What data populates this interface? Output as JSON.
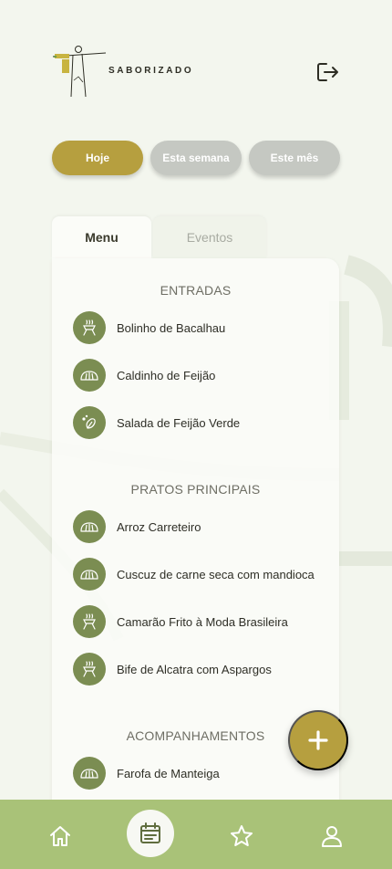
{
  "app": {
    "brand": "SABORIZADO"
  },
  "header": {
    "logo_icon": "christ-redeemer-logo",
    "logout_icon": "logout-icon"
  },
  "filters": [
    {
      "label": "Hoje",
      "active": true
    },
    {
      "label": "Esta semana",
      "active": false
    },
    {
      "label": "Este mês",
      "active": false
    }
  ],
  "tabs": [
    {
      "label": "Menu",
      "active": true
    },
    {
      "label": "Eventos",
      "active": false
    }
  ],
  "sections": [
    {
      "title": "ENTRADAS",
      "items": [
        {
          "name": "Bolinho de Bacalhau",
          "icon": "grill-icon"
        },
        {
          "name": "Caldinho de Feijão",
          "icon": "bread-icon"
        },
        {
          "name": "Salada de Feijão Verde",
          "icon": "salad-icon"
        }
      ]
    },
    {
      "title": "PRATOS PRINCIPAIS",
      "items": [
        {
          "name": "Arroz Carreteiro",
          "icon": "bread-icon"
        },
        {
          "name": "Cuscuz de carne seca com mandioca",
          "icon": "bread-icon"
        },
        {
          "name": "Camarão Frito à Moda Brasileira",
          "icon": "grill-icon"
        },
        {
          "name": "Bife de Alcatra com Aspargos",
          "icon": "grill-icon"
        }
      ]
    },
    {
      "title": "ACOMPANHAMENTOS",
      "items": [
        {
          "name": "Farofa de Manteiga",
          "icon": "bread-icon"
        }
      ]
    }
  ],
  "fab": {
    "icon": "plus-icon"
  },
  "bottom_nav": [
    {
      "icon": "home-icon",
      "active": false
    },
    {
      "icon": "calendar-icon",
      "active": true
    },
    {
      "icon": "star-icon",
      "active": false
    },
    {
      "icon": "user-icon",
      "active": false
    }
  ],
  "colors": {
    "accent": "#b69f3f",
    "icon_bg": "#7b8d52",
    "nav_bg": "#a9c278",
    "background": "#f3f6ee",
    "inactive_pill": "#c5c8c2"
  }
}
